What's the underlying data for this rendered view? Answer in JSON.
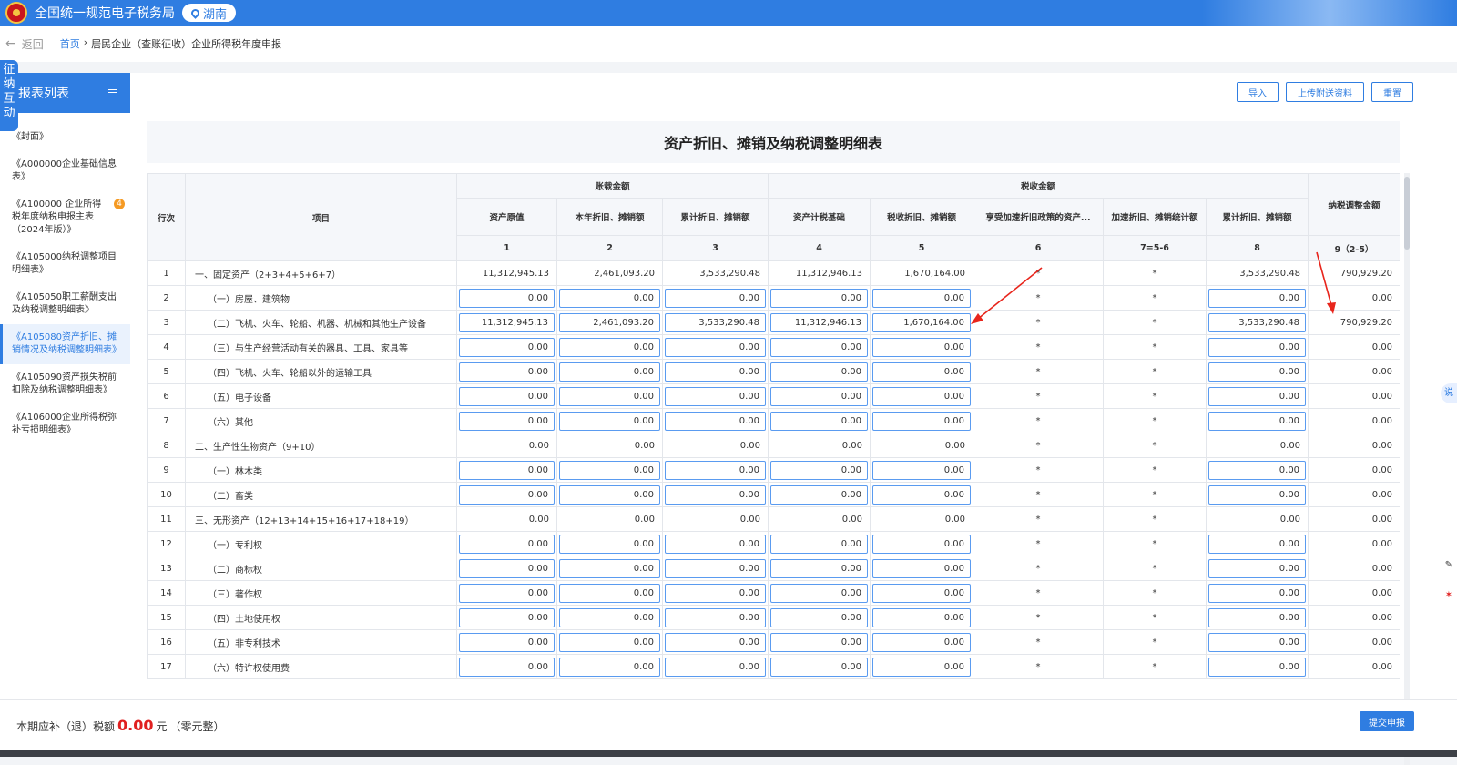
{
  "header": {
    "title": "全国统一规范电子税务局",
    "region": "湖南"
  },
  "breadcrumb": {
    "back": "返回",
    "home": "首页",
    "sep": "›",
    "current": "居民企业（查账征收）企业所得税年度申报"
  },
  "floating_tab": "征纳互动",
  "sidebar": {
    "title": "报表列表",
    "items": [
      {
        "label": "《封面》"
      },
      {
        "label": "《A000000企业基础信息表》"
      },
      {
        "label": "《A100000 企业所得税年度纳税申报主表（2024年版）》",
        "badge": "4"
      },
      {
        "label": "《A105000纳税调整项目明细表》"
      },
      {
        "label": "《A105050职工薪酬支出及纳税调整明细表》"
      },
      {
        "label": "《A105080资产折旧、摊销情况及纳税调整明细表》"
      },
      {
        "label": "《A105090资产损失税前扣除及纳税调整明细表》"
      },
      {
        "label": "《A106000企业所得税弥补亏损明细表》"
      }
    ]
  },
  "toolbar": {
    "import": "导入",
    "upload": "上传附送资料",
    "reset": "重置"
  },
  "form_title": "资产折旧、摊销及纳税调整明细表",
  "table": {
    "h_row": "行次",
    "h_item": "项目",
    "h_book": "账载金额",
    "h_tax": "税收金额",
    "h_adjust": "纳税调整金额",
    "cols": [
      "资产原值",
      "本年折旧、摊销额",
      "累计折旧、摊销额",
      "资产计税基础",
      "税收折旧、摊销额",
      "享受加速折旧政策的资产...",
      "加速折旧、摊销统计额",
      "累计折旧、摊销额"
    ],
    "col_nums": [
      "1",
      "2",
      "3",
      "4",
      "5",
      "6",
      "7=5-6",
      "8",
      "9（2-5）"
    ],
    "rows": [
      {
        "no": "1",
        "item": "一、固定资产（2+3+4+5+6+7）",
        "sub": false,
        "v": [
          "11,312,945.13",
          "2,461,093.20",
          "3,533,290.48",
          "11,312,946.13",
          "1,670,164.00",
          "*",
          "*",
          "3,533,290.48",
          "790,929.20"
        ]
      },
      {
        "no": "2",
        "item": "（一）房屋、建筑物",
        "sub": true,
        "v": [
          "0.00",
          "0.00",
          "0.00",
          "0.00",
          "0.00",
          "*",
          "*",
          "0.00",
          "0.00"
        ]
      },
      {
        "no": "3",
        "item": "（二）飞机、火车、轮船、机器、机械和其他生产设备",
        "sub": true,
        "v": [
          "11,312,945.13",
          "2,461,093.20",
          "3,533,290.48",
          "11,312,946.13",
          "1,670,164.00",
          "*",
          "*",
          "3,533,290.48",
          "790,929.20"
        ]
      },
      {
        "no": "4",
        "item": "（三）与生产经营活动有关的器具、工具、家具等",
        "sub": true,
        "v": [
          "0.00",
          "0.00",
          "0.00",
          "0.00",
          "0.00",
          "*",
          "*",
          "0.00",
          "0.00"
        ]
      },
      {
        "no": "5",
        "item": "（四）飞机、火车、轮船以外的运输工具",
        "sub": true,
        "v": [
          "0.00",
          "0.00",
          "0.00",
          "0.00",
          "0.00",
          "*",
          "*",
          "0.00",
          "0.00"
        ]
      },
      {
        "no": "6",
        "item": "（五）电子设备",
        "sub": true,
        "v": [
          "0.00",
          "0.00",
          "0.00",
          "0.00",
          "0.00",
          "*",
          "*",
          "0.00",
          "0.00"
        ]
      },
      {
        "no": "7",
        "item": "（六）其他",
        "sub": true,
        "v": [
          "0.00",
          "0.00",
          "0.00",
          "0.00",
          "0.00",
          "*",
          "*",
          "0.00",
          "0.00"
        ]
      },
      {
        "no": "8",
        "item": "二、生产性生物资产（9+10）",
        "sub": false,
        "v": [
          "0.00",
          "0.00",
          "0.00",
          "0.00",
          "0.00",
          "*",
          "*",
          "0.00",
          "0.00"
        ]
      },
      {
        "no": "9",
        "item": "（一）林木类",
        "sub": true,
        "v": [
          "0.00",
          "0.00",
          "0.00",
          "0.00",
          "0.00",
          "*",
          "*",
          "0.00",
          "0.00"
        ]
      },
      {
        "no": "10",
        "item": "（二）畜类",
        "sub": true,
        "v": [
          "0.00",
          "0.00",
          "0.00",
          "0.00",
          "0.00",
          "*",
          "*",
          "0.00",
          "0.00"
        ]
      },
      {
        "no": "11",
        "item": "三、无形资产（12+13+14+15+16+17+18+19）",
        "sub": false,
        "v": [
          "0.00",
          "0.00",
          "0.00",
          "0.00",
          "0.00",
          "*",
          "*",
          "0.00",
          "0.00"
        ]
      },
      {
        "no": "12",
        "item": "（一）专利权",
        "sub": true,
        "v": [
          "0.00",
          "0.00",
          "0.00",
          "0.00",
          "0.00",
          "*",
          "*",
          "0.00",
          "0.00"
        ]
      },
      {
        "no": "13",
        "item": "（二）商标权",
        "sub": true,
        "v": [
          "0.00",
          "0.00",
          "0.00",
          "0.00",
          "0.00",
          "*",
          "*",
          "0.00",
          "0.00"
        ]
      },
      {
        "no": "14",
        "item": "（三）著作权",
        "sub": true,
        "v": [
          "0.00",
          "0.00",
          "0.00",
          "0.00",
          "0.00",
          "*",
          "*",
          "0.00",
          "0.00"
        ]
      },
      {
        "no": "15",
        "item": "（四）土地使用权",
        "sub": true,
        "v": [
          "0.00",
          "0.00",
          "0.00",
          "0.00",
          "0.00",
          "*",
          "*",
          "0.00",
          "0.00"
        ]
      },
      {
        "no": "16",
        "item": "（五）非专利技术",
        "sub": true,
        "v": [
          "0.00",
          "0.00",
          "0.00",
          "0.00",
          "0.00",
          "*",
          "*",
          "0.00",
          "0.00"
        ]
      },
      {
        "no": "17",
        "item": "（六）特许权使用费",
        "sub": true,
        "v": [
          "0.00",
          "0.00",
          "0.00",
          "0.00",
          "0.00",
          "*",
          "*",
          "0.00",
          "0.00"
        ]
      }
    ]
  },
  "footer": {
    "label": "本期应补（退）税额",
    "amount": "0.00",
    "unit": "元",
    "note": "（零元整）",
    "submit": "提交申报"
  },
  "colors": {
    "primary": "#2f7de1",
    "danger": "#e02020",
    "arrow": "#e8251c"
  }
}
